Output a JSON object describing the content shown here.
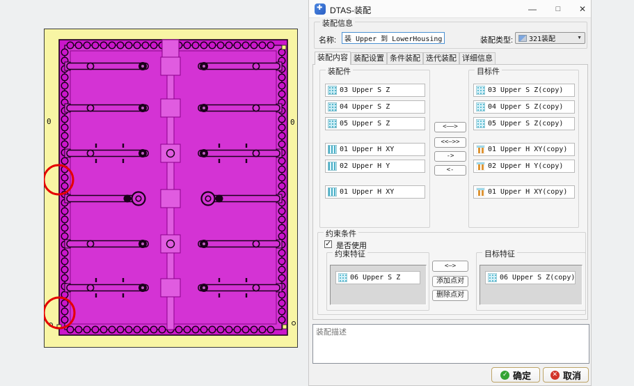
{
  "window": {
    "title": "DTAS-装配",
    "controls": {
      "minimize": "—",
      "maximize": "□",
      "close": "✕"
    }
  },
  "assembly_info": {
    "group_label": "装配信息",
    "name_label": "名称:",
    "name_value": "装 Upper 到 LowerHousing",
    "type_label": "装配类型:",
    "type_value": "321装配"
  },
  "tabs": [
    {
      "label": "装配内容"
    },
    {
      "label": "装配设置"
    },
    {
      "label": "条件装配"
    },
    {
      "label": "迭代装配"
    },
    {
      "label": "详细信息"
    }
  ],
  "assembly_parts": {
    "group_label": "装配件",
    "items": [
      {
        "icon": "surface-grid-icon",
        "label": "03 Upper S Z"
      },
      {
        "icon": "surface-grid-icon",
        "label": "04 Upper S Z"
      },
      {
        "icon": "surface-grid-icon",
        "label": "05 Upper S Z"
      },
      {
        "icon": "hole-stripe-icon",
        "label": "01 Upper H XY"
      },
      {
        "icon": "hole-stripe-icon",
        "label": "02 Upper H Y"
      },
      {
        "icon": "hole-stripe-icon",
        "label": "01 Upper H XY"
      }
    ]
  },
  "target_parts": {
    "group_label": "目标件",
    "items": [
      {
        "icon": "surface-dot-icon",
        "label": "03 Upper S Z(copy)"
      },
      {
        "icon": "surface-dot-icon",
        "label": "04 Upper S Z(copy)"
      },
      {
        "icon": "surface-dot-icon",
        "label": "05 Upper S Z(copy)"
      },
      {
        "icon": "pin-icon",
        "label": "01 Upper H XY(copy)"
      },
      {
        "icon": "pin-icon",
        "label": "02 Upper H Y(copy)"
      },
      {
        "icon": "pin-icon",
        "label": "01 Upper H XY(copy)"
      }
    ]
  },
  "transfer_buttons": [
    "<——>",
    "<<—>>",
    "->",
    "<-"
  ],
  "constraint": {
    "group_label": "约束条件",
    "use_label": "是否使用",
    "checked": true,
    "source_group_label": "约束特征",
    "source_item": {
      "icon": "surface-dot-icon",
      "label": "06 Upper S Z"
    },
    "buttons": [
      "<—>",
      "添加点对",
      "删除点对"
    ],
    "target_group_label": "目标特征",
    "target_item": {
      "icon": "surface-dot-icon",
      "label": "06 Upper S Z(copy)"
    }
  },
  "description": {
    "placeholder": "装配描述",
    "value": ""
  },
  "footer": {
    "ok_label": "确定",
    "cancel_label": "取消"
  },
  "cad_view": {
    "marks": {
      "left_zero": "0",
      "right_zero": "0"
    },
    "colors": {
      "background": "#f8f5a4",
      "part_magenta": "#d433d4",
      "band_magenta": "#cb16cb",
      "spine_pink": "#e05ce0",
      "outline": "#1a001a",
      "annotation_red": "#e40000"
    }
  }
}
